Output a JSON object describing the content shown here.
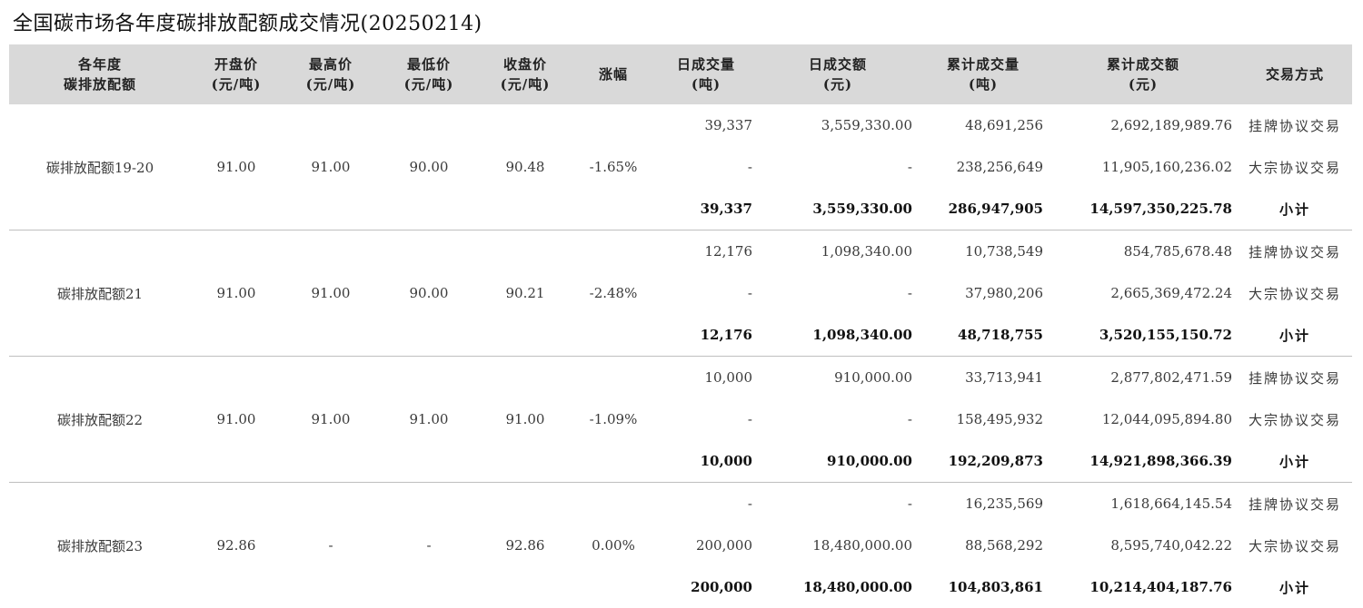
{
  "title": "全国碳市场各年度碳排放配额成交情况(20250214)",
  "headers": [
    "各年度\n碳排放配额",
    "开盘价\n(元/吨)",
    "最高价\n(元/吨)",
    "最低价\n(元/吨)",
    "收盘价\n(元/吨)",
    "涨幅",
    "日成交量\n(吨)",
    "日成交额\n(元)",
    "累计成交量\n(吨)",
    "累计成交额\n(元)",
    "交易方式"
  ],
  "groups": [
    {
      "name": "碳排放配额19-20",
      "open": "91.00",
      "high": "91.00",
      "low": "90.00",
      "close": "90.48",
      "change": "-1.65%",
      "rows": [
        {
          "vol": "39,337",
          "amt": "3,559,330.00",
          "cum_vol": "48,691,256",
          "cum_amt": "2,692,189,989.76",
          "mode": "挂牌协议交易"
        },
        {
          "vol": "-",
          "amt": "-",
          "cum_vol": "238,256,649",
          "cum_amt": "11,905,160,236.02",
          "mode": "大宗协议交易"
        },
        {
          "vol": "39,337",
          "amt": "3,559,330.00",
          "cum_vol": "286,947,905",
          "cum_amt": "14,597,350,225.78",
          "mode": "小计"
        }
      ]
    },
    {
      "name": "碳排放配额21",
      "open": "91.00",
      "high": "91.00",
      "low": "90.00",
      "close": "90.21",
      "change": "-2.48%",
      "rows": [
        {
          "vol": "12,176",
          "amt": "1,098,340.00",
          "cum_vol": "10,738,549",
          "cum_amt": "854,785,678.48",
          "mode": "挂牌协议交易"
        },
        {
          "vol": "-",
          "amt": "-",
          "cum_vol": "37,980,206",
          "cum_amt": "2,665,369,472.24",
          "mode": "大宗协议交易"
        },
        {
          "vol": "12,176",
          "amt": "1,098,340.00",
          "cum_vol": "48,718,755",
          "cum_amt": "3,520,155,150.72",
          "mode": "小计"
        }
      ]
    },
    {
      "name": "碳排放配额22",
      "open": "91.00",
      "high": "91.00",
      "low": "91.00",
      "close": "91.00",
      "change": "-1.09%",
      "rows": [
        {
          "vol": "10,000",
          "amt": "910,000.00",
          "cum_vol": "33,713,941",
          "cum_amt": "2,877,802,471.59",
          "mode": "挂牌协议交易"
        },
        {
          "vol": "-",
          "amt": "-",
          "cum_vol": "158,495,932",
          "cum_amt": "12,044,095,894.80",
          "mode": "大宗协议交易"
        },
        {
          "vol": "10,000",
          "amt": "910,000.00",
          "cum_vol": "192,209,873",
          "cum_amt": "14,921,898,366.39",
          "mode": "小计"
        }
      ]
    },
    {
      "name": "碳排放配额23",
      "open": "92.86",
      "high": "-",
      "low": "-",
      "close": "92.86",
      "change": "0.00%",
      "rows": [
        {
          "vol": "-",
          "amt": "-",
          "cum_vol": "16,235,569",
          "cum_amt": "1,618,664,145.54",
          "mode": "挂牌协议交易"
        },
        {
          "vol": "200,000",
          "amt": "18,480,000.00",
          "cum_vol": "88,568,292",
          "cum_amt": "8,595,740,042.22",
          "mode": "大宗协议交易"
        },
        {
          "vol": "200,000",
          "amt": "18,480,000.00",
          "cum_vol": "104,803,861",
          "cum_amt": "10,214,404,187.76",
          "mode": "小计"
        }
      ]
    }
  ]
}
